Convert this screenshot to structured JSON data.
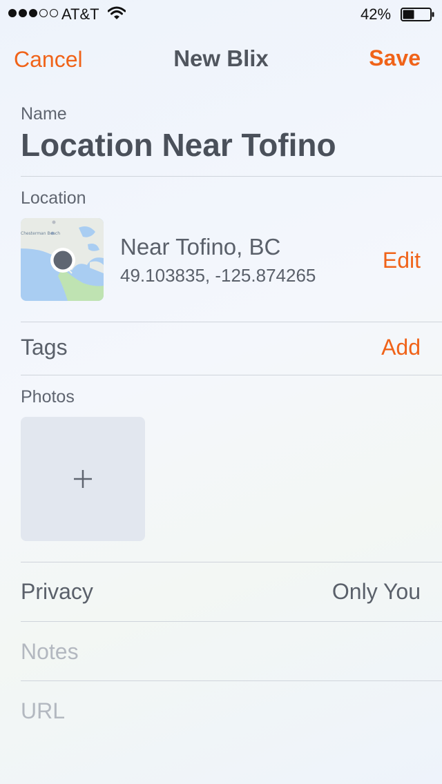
{
  "status_bar": {
    "carrier": "AT&T",
    "battery_percent": "42%",
    "signal_bars_filled": 3,
    "signal_bars_total": 5,
    "battery_level": 0.42
  },
  "nav": {
    "cancel_label": "Cancel",
    "title": "New Blix",
    "save_label": "Save"
  },
  "form": {
    "name_label": "Name",
    "name_value": "Location Near Tofino",
    "location_label": "Location",
    "location_name": "Near Tofino, BC",
    "location_coords": "49.103835, -125.874265",
    "map_label": "Chesterman Beach",
    "edit_label": "Edit",
    "tags_label": "Tags",
    "tags_action": "Add",
    "photos_label": "Photos",
    "add_photo_symbol": "+",
    "privacy_label": "Privacy",
    "privacy_value": "Only You",
    "notes_placeholder": "Notes",
    "url_placeholder": "URL"
  },
  "colors": {
    "accent": "#f06319",
    "text": "#4a505a",
    "placeholder": "#b3b8c0",
    "divider": "#cfd4db",
    "map_water": "#a9cdf2",
    "map_land": "#e8ebe6",
    "map_park": "#bfe3b2"
  },
  "icons": {
    "wifi": "wifi-icon",
    "battery": "battery-icon",
    "map_pin": "map-pin-icon",
    "add": "plus-icon"
  }
}
